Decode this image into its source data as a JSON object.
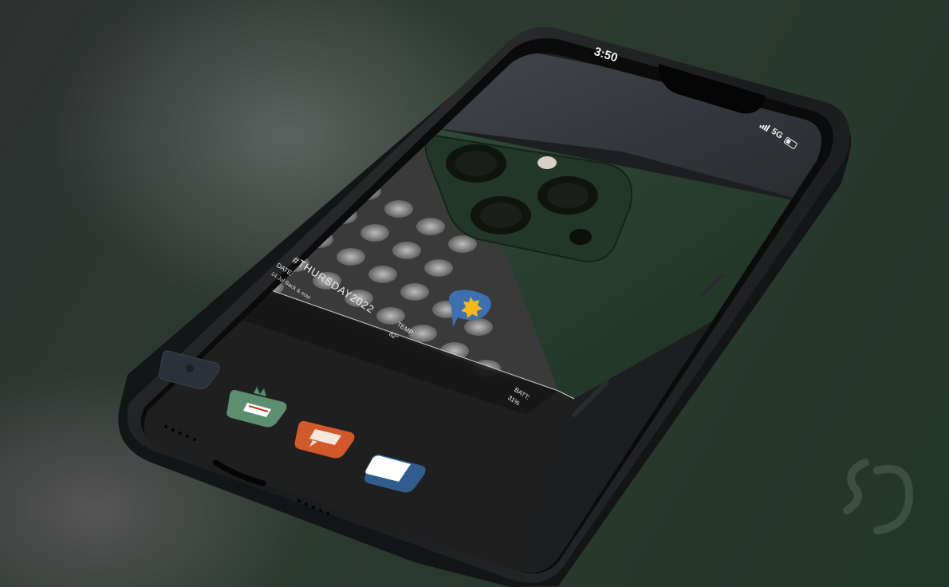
{
  "status_bar": {
    "time": "3:50",
    "network": "5G"
  },
  "widget": {
    "title": "#THURSDAY2022",
    "date_label": "DATE:",
    "date_value": "14 Jul Back & now",
    "temp_label": "TEMP:",
    "temp_value": "82°",
    "battery_label": "BATT:",
    "battery_value": "31%",
    "weather_icon": "sun-cloud-icon"
  },
  "dock": {
    "apps": [
      {
        "name": "camera-app-icon",
        "color": "#2a3138"
      },
      {
        "name": "monster-app-icon",
        "color": "#5b8f6f"
      },
      {
        "name": "chat-app-icon",
        "color": "#d2592b"
      },
      {
        "name": "notes-app-icon",
        "color": "#2f5d8e"
      }
    ]
  },
  "colors": {
    "wallpaper_green": "#27392e",
    "frame": "#1c1d1e",
    "accent_orange": "#d2592b",
    "accent_yellow": "#f4b81c"
  },
  "watermark": "S"
}
